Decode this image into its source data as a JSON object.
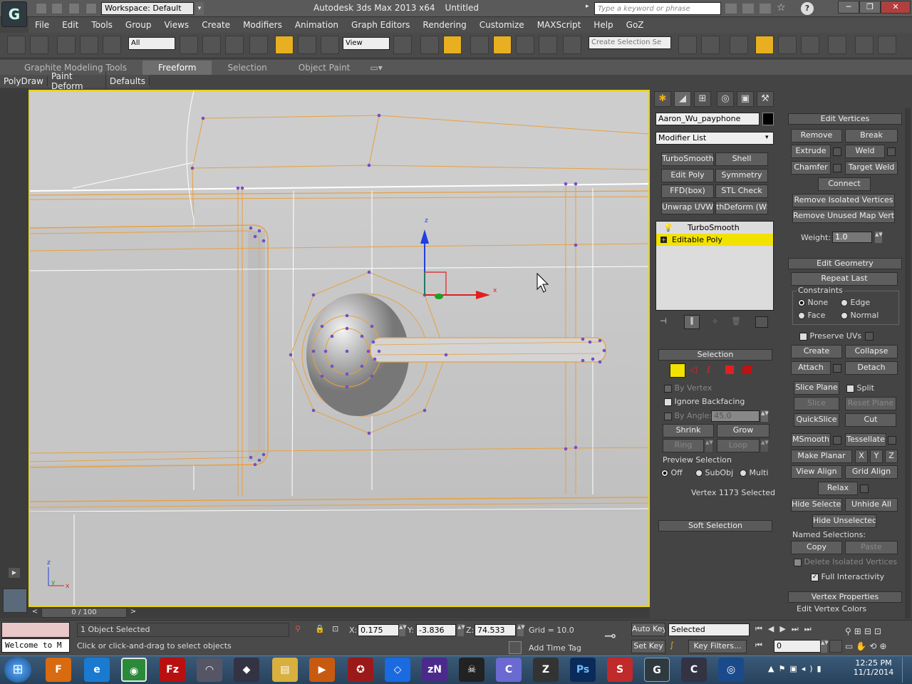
{
  "titlebar": {
    "workspace": "Workspace: Default",
    "app_title": "Autodesk 3ds Max  2013 x64",
    "doc_title": "Untitled",
    "search_placeholder": "Type a keyword or phrase"
  },
  "menu": [
    "File",
    "Edit",
    "Tools",
    "Group",
    "Views",
    "Create",
    "Modifiers",
    "Animation",
    "Graph Editors",
    "Rendering",
    "Customize",
    "MAXScript",
    "Help",
    "GoZ"
  ],
  "toolbar": {
    "filter": "All",
    "ref_coord": "View",
    "selection_set": "Create Selection Se"
  },
  "ribbon": {
    "tabs": [
      "Graphite Modeling Tools",
      "Freeform",
      "Selection",
      "Object Paint"
    ],
    "active": "Freeform",
    "subtabs": [
      "PolyDraw",
      "Paint Deform",
      "Defaults"
    ]
  },
  "viewport": {
    "axis_x": "x",
    "axis_y": "y",
    "axis_z": "z"
  },
  "timeslider": "0 / 100",
  "command_panel": {
    "object_name": "Aaron_Wu_payphone",
    "modifier_list": "Modifier List",
    "modifier_buttons": [
      "TurboSmooth",
      "Shell",
      "Edit Poly",
      "Symmetry",
      "FFD(box)",
      "STL Check",
      "Unwrap UVW",
      "thDeform (WSI"
    ],
    "stack": [
      "TurboSmooth",
      "Editable Poly"
    ],
    "selection_title": "Selection",
    "by_vertex": "By Vertex",
    "ignore_backfacing": "Ignore Backfacing",
    "by_angle": "By Angle:",
    "angle_value": "45.0",
    "shrink": "Shrink",
    "grow": "Grow",
    "ring": "Ring",
    "loop": "Loop",
    "preview_selection": "Preview Selection",
    "preview_off": "Off",
    "preview_subobj": "SubObj",
    "preview_multi": "Multi",
    "status": "Vertex 1173 Selected",
    "soft_selection": "Soft Selection"
  },
  "edit_vertices": {
    "title": "Edit Vertices",
    "remove": "Remove",
    "break": "Break",
    "extrude": "Extrude",
    "weld": "Weld",
    "chamfer": "Chamfer",
    "target_weld": "Target Weld",
    "connect": "Connect",
    "remove_isolated": "Remove Isolated Vertices",
    "remove_unused": "Remove Unused Map Verts",
    "weight_label": "Weight:",
    "weight_value": "1.0"
  },
  "edit_geometry": {
    "title": "Edit Geometry",
    "repeat_last": "Repeat Last",
    "constraints": "Constraints",
    "none": "None",
    "edge": "Edge",
    "face": "Face",
    "normal": "Normal",
    "preserve_uvs": "Preserve UVs",
    "create": "Create",
    "collapse": "Collapse",
    "attach": "Attach",
    "detach": "Detach",
    "slice_plane": "Slice Plane",
    "split": "Split",
    "slice": "Slice",
    "reset_plane": "Reset Plane",
    "quickslice": "QuickSlice",
    "cut": "Cut",
    "msmooth": "MSmooth",
    "tessellate": "Tessellate",
    "make_planar": "Make Planar",
    "x": "X",
    "y": "Y",
    "z": "Z",
    "view_align": "View Align",
    "grid_align": "Grid Align",
    "relax": "Relax",
    "hide_selected": "Hide Selected",
    "unhide_all": "Unhide All",
    "hide_unselected": "Hide Unselected",
    "named_selections": "Named Selections:",
    "copy": "Copy",
    "paste": "Paste",
    "delete_isolated": "Delete Isolated Vertices",
    "full_interactivity": "Full Interactivity"
  },
  "vertex_properties": {
    "title": "Vertex Properties",
    "edit_colors": "Edit Vertex Colors"
  },
  "status": {
    "maxscript": "Welcome to M",
    "selected": "1 Object Selected",
    "prompt": "Click or click-and-drag to select objects",
    "x_label": "X:",
    "x": "0.175",
    "y_label": "Y:",
    "y": "-3.836",
    "z_label": "Z:",
    "z": "74.533",
    "grid": "Grid = 10.0",
    "add_time_tag": "Add Time Tag",
    "auto_key": "Auto Key",
    "set_key": "Set Key",
    "key_mode": "Selected",
    "key_filters": "Key Filters...",
    "frame": "0"
  },
  "taskbar": {
    "time": "12:25 PM",
    "date": "11/1/2014"
  },
  "colors": {
    "selection_orange": "#e8a040",
    "vertex_purple": "#7050c8",
    "viewport_border": "#e8d418"
  }
}
